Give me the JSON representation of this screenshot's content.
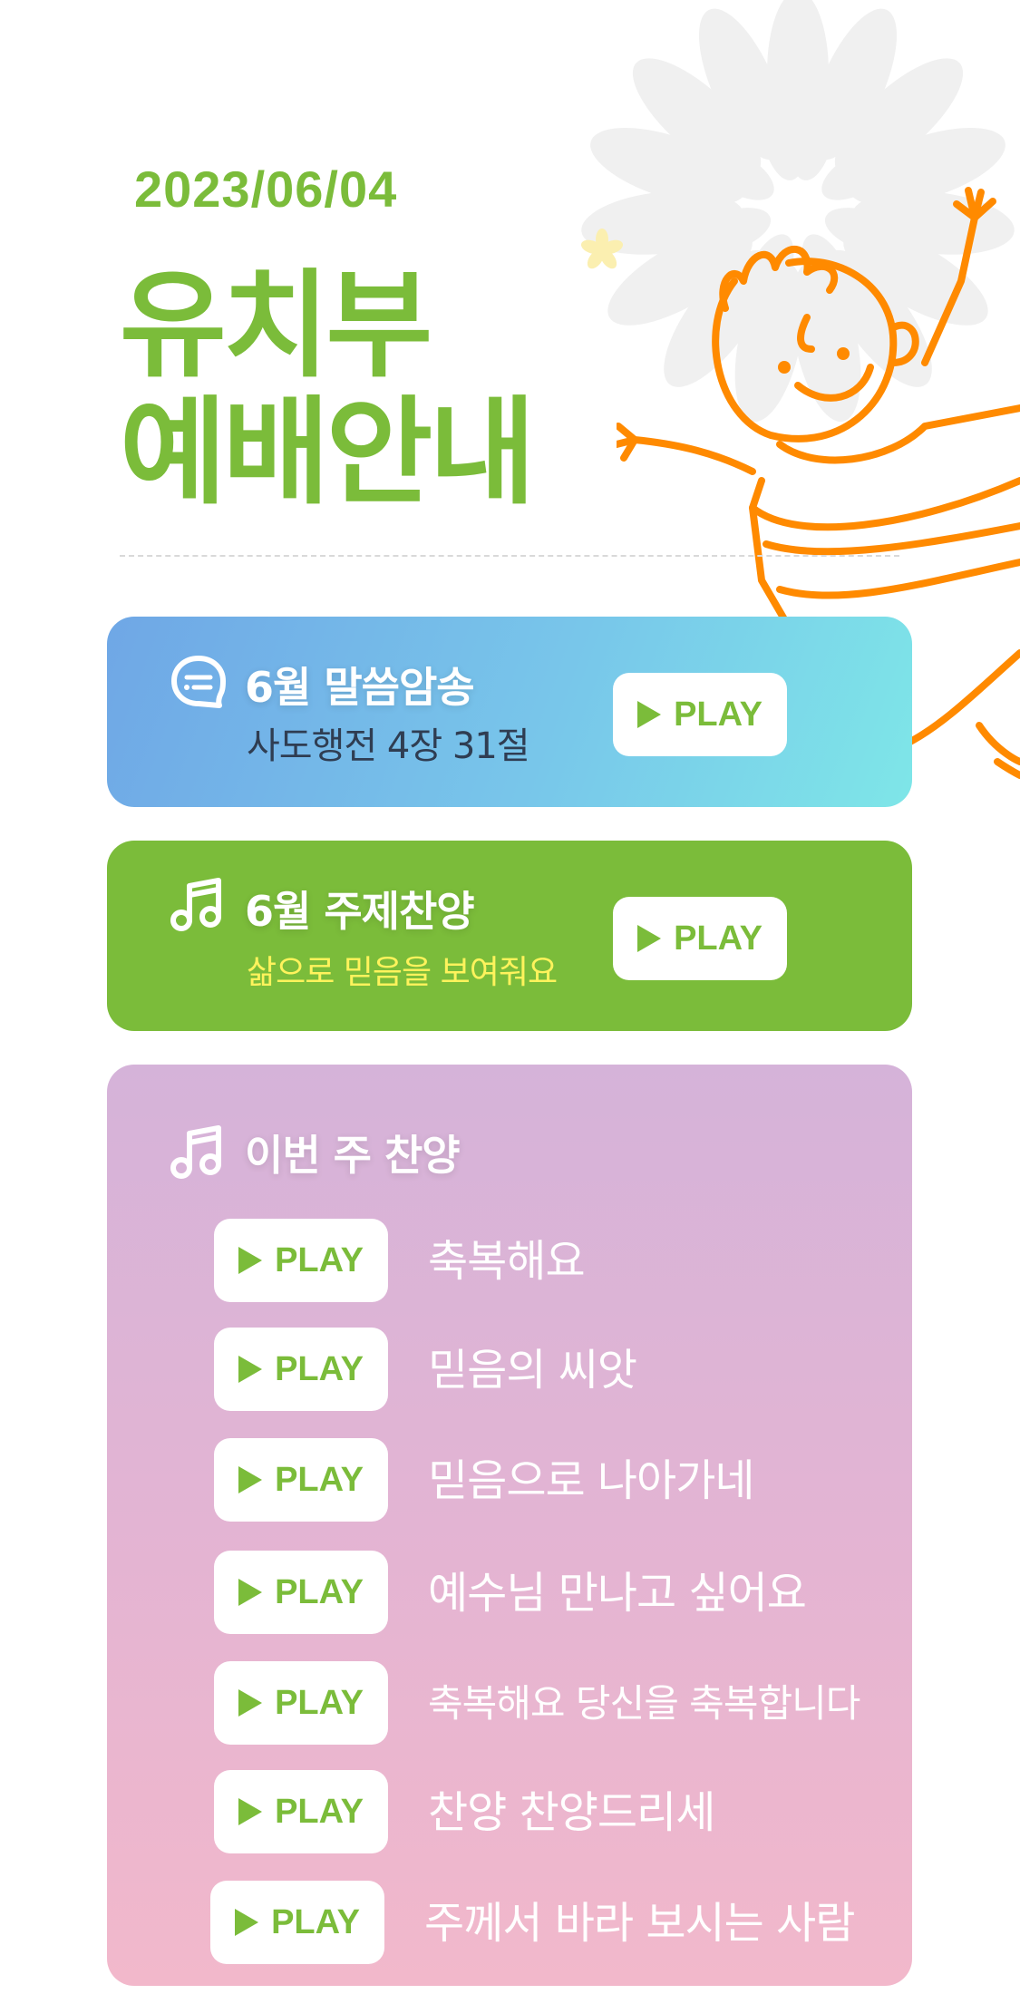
{
  "header": {
    "date": "2023/06/04",
    "title_line1": "유치부",
    "title_line2": "예배안내"
  },
  "memory_verse": {
    "icon": "chat-bubble-icon",
    "title": "6월 말씀암송",
    "subtitle": "사도행전 4장 31절",
    "play_label": "PLAY"
  },
  "theme_song": {
    "icon": "music-note-icon",
    "title": "6월 주제찬양",
    "subtitle": "삶으로 믿음을 보여줘요",
    "play_label": "PLAY"
  },
  "weekly_songs": {
    "icon": "music-note-icon",
    "title": "이번 주 찬양",
    "items": [
      {
        "play_label": "PLAY",
        "title": "축복해요"
      },
      {
        "play_label": "PLAY",
        "title": "믿음의 씨앗"
      },
      {
        "play_label": "PLAY",
        "title": "믿음으로 나아가네"
      },
      {
        "play_label": "PLAY",
        "title": "예수님 만나고 싶어요"
      },
      {
        "play_label": "PLAY",
        "title": "축복해요 당신을 축복합니다"
      },
      {
        "play_label": "PLAY",
        "title": "찬양 찬양드리세"
      },
      {
        "play_label": "PLAY",
        "title": "주께서 바라 보시는 사람"
      }
    ]
  },
  "colors": {
    "accent_green": "#7bbc3a",
    "illustration_orange": "#ff8a00",
    "subtitle_yellow": "#fff35c"
  }
}
